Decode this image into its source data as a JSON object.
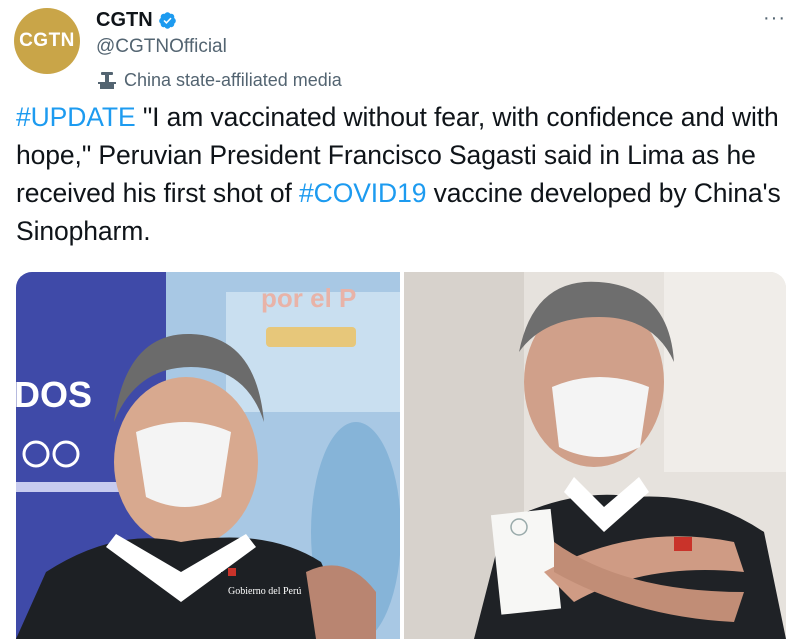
{
  "account": {
    "display_name": "CGTN",
    "handle": "@CGTNOfficial",
    "avatar_text": "CGTN",
    "verified_icon": "verified-badge-icon",
    "affiliation": "China state-affiliated media",
    "affiliation_icon": "podium-icon"
  },
  "menu": {
    "more_label": "···"
  },
  "tweet": {
    "segments": [
      {
        "text": "#UPDATE",
        "type": "hashtag"
      },
      {
        "text": " \"I am vaccinated without fear, with confidence and with hope,\" Peruvian President Francisco Sagasti said in Lima as he received his first shot of ",
        "type": "text"
      },
      {
        "text": "#COVID19",
        "type": "hashtag"
      },
      {
        "text": " vaccine developed by China's Sinopharm.",
        "type": "text"
      }
    ]
  },
  "media": {
    "photo_left": {
      "banner_text": "DOS",
      "banner_text_2": "por el P",
      "badge_text": "Gobierno del Perú"
    },
    "photo_right": {}
  },
  "colors": {
    "link": "#1d9bf0",
    "avatar_bg": "#c9a548",
    "secondary_text": "#536471"
  }
}
